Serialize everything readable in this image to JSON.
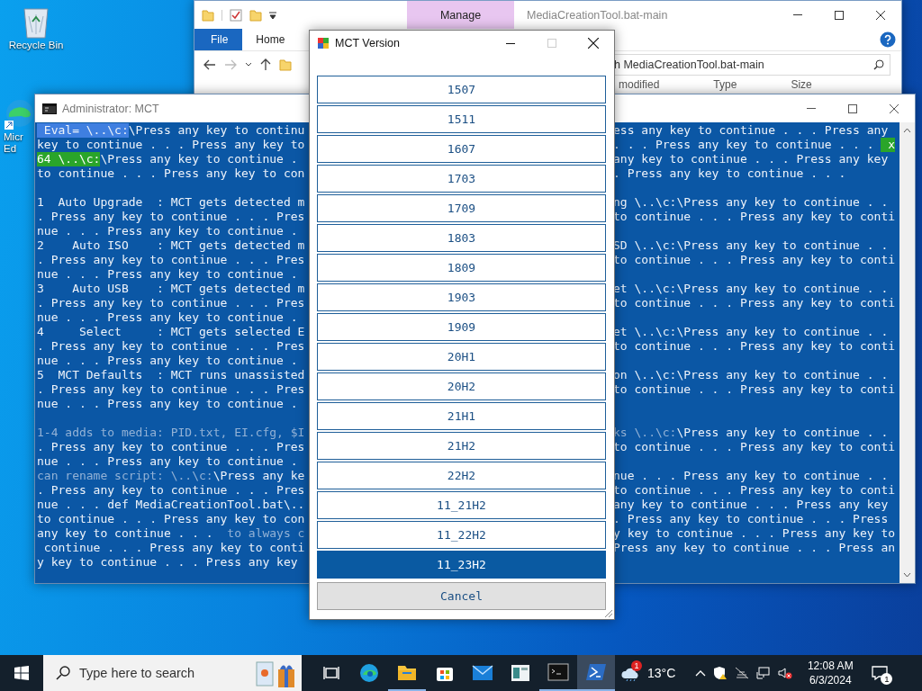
{
  "desktop_icons": [
    {
      "kind": "recycle",
      "label_lines": [
        "Recycle Bin"
      ]
    },
    {
      "kind": "edge",
      "label_lines": [
        "Micr",
        "Ed"
      ]
    }
  ],
  "explorer": {
    "context_tab": "Manage",
    "title": "MediaCreationTool.bat-main",
    "ribbon_tabs": [
      {
        "label": "File",
        "kind": "file"
      },
      {
        "label": "Home",
        "kind": "tab"
      }
    ],
    "search_value": "h MediaCreationTool.bat-main",
    "columns": [
      "modified",
      "Type",
      "Size"
    ]
  },
  "console": {
    "title": "Administrator:  MCT",
    "rows": [
      {
        "left": [
          {
            "text": " Eval= \\..\\c:",
            "kind": "selected"
          },
          {
            "text": "\\Press any key to continu",
            "kind": "normal"
          }
        ],
        "right": [
          {
            "text": "ess any key to continue . . . Press any",
            "kind": "normal"
          }
        ]
      },
      {
        "left": [
          {
            "text": "key to continue . . . Press any key to",
            "kind": "normal"
          }
        ],
        "right": [
          {
            "text": ". . . Press any key to continue . . . ",
            "kind": "normal"
          },
          {
            "text": " x",
            "kind": "green"
          }
        ]
      },
      {
        "left": [
          {
            "text": "64 \\..\\c:",
            "kind": "green"
          },
          {
            "text": "\\Press any key to continue .",
            "kind": "normal"
          }
        ],
        "right": [
          {
            "text": "any key to continue . . . Press any key",
            "kind": "normal"
          }
        ]
      },
      {
        "left": [
          {
            "text": "to continue . . . Press any key to con",
            "kind": "normal"
          }
        ],
        "right": [
          {
            "text": ". Press any key to continue . . .",
            "kind": "normal"
          }
        ]
      },
      {
        "left": [],
        "right": []
      },
      {
        "left": [
          {
            "text": "1  Auto Upgrade  : MCT gets detected m",
            "kind": "normal"
          }
        ],
        "right": [
          {
            "text": "ng \\..\\c:\\Press any key to continue . .",
            "kind": "normal"
          }
        ]
      },
      {
        "left": [
          {
            "text": ". Press any key to continue . . . Pres",
            "kind": "normal"
          }
        ],
        "right": [
          {
            "text": "to continue . . . Press any key to conti",
            "kind": "normal"
          }
        ]
      },
      {
        "left": [
          {
            "text": "nue . . . Press any key to continue .",
            "kind": "normal"
          }
        ],
        "right": []
      },
      {
        "left": [
          {
            "text": "2    Auto ISO    : MCT gets detected m",
            "kind": "normal"
          }
        ],
        "right": [
          {
            "text": "SD \\..\\c:\\Press any key to continue . .",
            "kind": "normal"
          }
        ]
      },
      {
        "left": [
          {
            "text": ". Press any key to continue . . . Pres",
            "kind": "normal"
          }
        ],
        "right": [
          {
            "text": "to continue . . . Press any key to conti",
            "kind": "normal"
          }
        ]
      },
      {
        "left": [
          {
            "text": "nue . . . Press any key to continue .",
            "kind": "normal"
          }
        ],
        "right": []
      },
      {
        "left": [
          {
            "text": "3    Auto USB    : MCT gets detected m",
            "kind": "normal"
          }
        ],
        "right": [
          {
            "text": "et \\..\\c:\\Press any key to continue . .",
            "kind": "normal"
          }
        ]
      },
      {
        "left": [
          {
            "text": ". Press any key to continue . . . Pres",
            "kind": "normal"
          }
        ],
        "right": [
          {
            "text": "to continue . . . Press any key to conti",
            "kind": "normal"
          }
        ]
      },
      {
        "left": [
          {
            "text": "nue . . . Press any key to continue .",
            "kind": "normal"
          }
        ],
        "right": []
      },
      {
        "left": [
          {
            "text": "4     Select     : MCT gets selected E",
            "kind": "normal"
          }
        ],
        "right": [
          {
            "text": "et \\..\\c:\\Press any key to continue . .",
            "kind": "normal"
          }
        ]
      },
      {
        "left": [
          {
            "text": ". Press any key to continue . . . Pres",
            "kind": "normal"
          }
        ],
        "right": [
          {
            "text": "to continue . . . Press any key to conti",
            "kind": "normal"
          }
        ]
      },
      {
        "left": [
          {
            "text": "nue . . . Press any key to continue .",
            "kind": "normal"
          }
        ],
        "right": []
      },
      {
        "left": [
          {
            "text": "5  MCT Defaults  : MCT runs unassisted",
            "kind": "normal"
          }
        ],
        "right": [
          {
            "text": "on \\..\\c:\\Press any key to continue . .",
            "kind": "normal"
          }
        ]
      },
      {
        "left": [
          {
            "text": ". Press any key to continue . . . Pres",
            "kind": "normal"
          }
        ],
        "right": [
          {
            "text": "to continue . . . Press any key to conti",
            "kind": "normal"
          }
        ]
      },
      {
        "left": [
          {
            "text": "nue . . . Press any key to continue .",
            "kind": "normal"
          }
        ],
        "right": []
      },
      {
        "left": [],
        "right": []
      },
      {
        "left": [
          {
            "text": "1-4 adds to media: PID.txt, EI.cfg, $I",
            "kind": "dim"
          }
        ],
        "right": [
          {
            "text": "ks \\..\\c:",
            "kind": "dim"
          },
          {
            "text": "\\Press any key to continue . .",
            "kind": "normal"
          }
        ]
      },
      {
        "left": [
          {
            "text": ". Press any key to continue . . . Pres",
            "kind": "normal"
          }
        ],
        "right": [
          {
            "text": "to continue . . . Press any key to conti",
            "kind": "normal"
          }
        ]
      },
      {
        "left": [
          {
            "text": "nue . . . Press any key to continue .",
            "kind": "normal"
          }
        ],
        "right": []
      },
      {
        "left": [
          {
            "text": "can rename script: \\..\\c:",
            "kind": "dim"
          },
          {
            "text": "\\Press any ke",
            "kind": "normal"
          }
        ],
        "right": [
          {
            "text": "nue . . . Press any key to continue . .",
            "kind": "normal"
          }
        ]
      },
      {
        "left": [
          {
            "text": ". Press any key to continue . . . Pres",
            "kind": "normal"
          }
        ],
        "right": [
          {
            "text": "to continue . . . Press any key to conti",
            "kind": "normal"
          }
        ]
      },
      {
        "left": [
          {
            "text": "nue . . . def MediaCreationTool.bat\\..",
            "kind": "normal"
          }
        ],
        "right": [
          {
            "text": "any key to continue . . . Press any key",
            "kind": "normal"
          }
        ]
      },
      {
        "left": [
          {
            "text": "to continue . . . Press any key to con",
            "kind": "normal"
          }
        ],
        "right": [
          {
            "text": ". Press any key to continue . . . Press",
            "kind": "normal"
          }
        ]
      },
      {
        "left": [
          {
            "text": "any key to continue . . .  ",
            "kind": "normal"
          },
          {
            "text": "to always c",
            "kind": "dim"
          }
        ],
        "right": [
          {
            "text": "y key to continue . . . Press any key to",
            "kind": "normal"
          }
        ]
      },
      {
        "left": [
          {
            "text": " continue . . . Press any key to conti",
            "kind": "normal"
          }
        ],
        "right": [
          {
            "text": "Press any key to continue . . . Press an",
            "kind": "normal"
          }
        ]
      },
      {
        "left": [
          {
            "text": "y key to continue . . . Press any key",
            "kind": "normal"
          }
        ],
        "right": []
      }
    ]
  },
  "dialog": {
    "title": "MCT Version",
    "options": [
      {
        "label": "1507",
        "selected": false
      },
      {
        "label": "1511",
        "selected": false
      },
      {
        "label": "1607",
        "selected": false
      },
      {
        "label": "1703",
        "selected": false
      },
      {
        "label": "1709",
        "selected": false
      },
      {
        "label": "1803",
        "selected": false
      },
      {
        "label": "1809",
        "selected": false
      },
      {
        "label": "1903",
        "selected": false
      },
      {
        "label": "1909",
        "selected": false
      },
      {
        "label": "20H1",
        "selected": false
      },
      {
        "label": "20H2",
        "selected": false
      },
      {
        "label": "21H1",
        "selected": false
      },
      {
        "label": "21H2",
        "selected": false
      },
      {
        "label": "22H2",
        "selected": false
      },
      {
        "label": "11_21H2",
        "selected": false
      },
      {
        "label": "11_22H2",
        "selected": false
      },
      {
        "label": "11_23H2",
        "selected": true
      }
    ],
    "cancel": "Cancel"
  },
  "taskbar": {
    "search_placeholder": "Type here to search",
    "apps": [
      {
        "kind": "task-view",
        "running": false,
        "active": false
      },
      {
        "kind": "edge",
        "running": false,
        "active": false
      },
      {
        "kind": "explorer",
        "running": true,
        "active": false
      },
      {
        "kind": "store",
        "running": false,
        "active": false
      },
      {
        "kind": "mail",
        "running": false,
        "active": false
      },
      {
        "kind": "window",
        "running": false,
        "active": false
      },
      {
        "kind": "terminal",
        "running": true,
        "active": false
      },
      {
        "kind": "powershell",
        "running": true,
        "active": true
      }
    ],
    "weather": {
      "temp": "13°C",
      "badge": "1"
    },
    "clock": {
      "time": "12:08 AM",
      "date": "6/3/2024"
    },
    "notifications": "1"
  }
}
